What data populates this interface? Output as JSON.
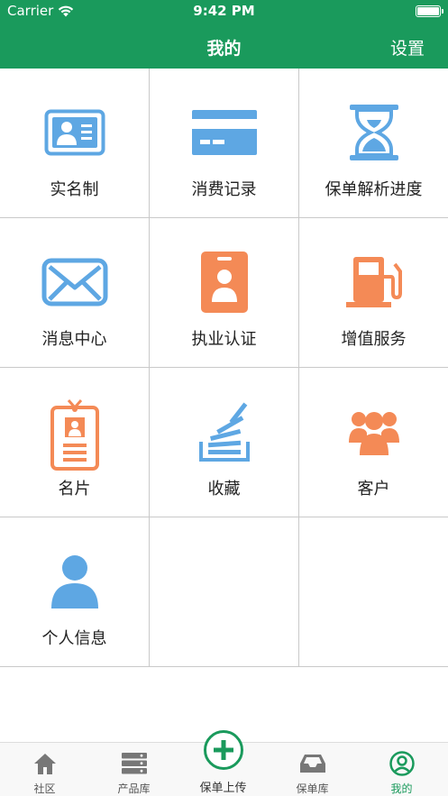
{
  "status_bar": {
    "carrier": "Carrier",
    "time": "9:42 PM"
  },
  "nav": {
    "title": "我的",
    "settings": "设置"
  },
  "grid": {
    "items": [
      {
        "label": "实名制",
        "icon": "id-card-icon"
      },
      {
        "label": "消费记录",
        "icon": "credit-card-icon"
      },
      {
        "label": "保单解析进度",
        "icon": "hourglass-icon"
      },
      {
        "label": "消息中心",
        "icon": "envelope-icon"
      },
      {
        "label": "执业认证",
        "icon": "badge-icon"
      },
      {
        "label": "增值服务",
        "icon": "fuel-pump-icon"
      },
      {
        "label": "名片",
        "icon": "name-card-icon"
      },
      {
        "label": "收藏",
        "icon": "stack-icon"
      },
      {
        "label": "客户",
        "icon": "customers-icon"
      },
      {
        "label": "个人信息",
        "icon": "user-icon"
      }
    ]
  },
  "tabs": [
    {
      "label": "社区",
      "icon": "home-icon"
    },
    {
      "label": "产品库",
      "icon": "server-icon"
    },
    {
      "label": "保单上传",
      "icon": "plus-circle-icon"
    },
    {
      "label": "保单库",
      "icon": "inbox-icon"
    },
    {
      "label": "我的",
      "icon": "user-circle-icon"
    }
  ],
  "colors": {
    "brand_green": "#1a9a5c",
    "icon_blue": "#5ea7e3",
    "icon_orange": "#f48a56"
  }
}
